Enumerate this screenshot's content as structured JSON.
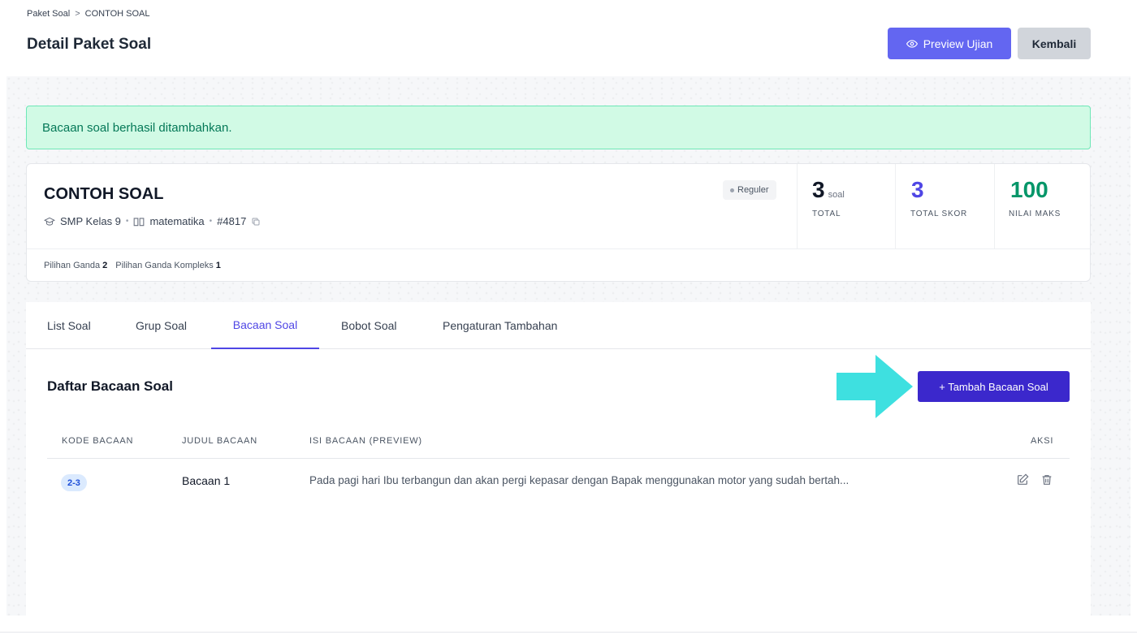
{
  "breadcrumb": {
    "items": [
      "Paket Soal",
      "CONTOH SOAL"
    ],
    "separator": ">"
  },
  "header": {
    "title": "Detail Paket Soal",
    "preview_label": "Preview Ujian",
    "back_label": "Kembali"
  },
  "alert": {
    "message": "Bacaan soal berhasil ditambahkan."
  },
  "package": {
    "title": "CONTOH SOAL",
    "level": "SMP Kelas 9",
    "subject": "matematika",
    "id": "#4817",
    "badge": "Reguler",
    "stats": [
      {
        "value": "3",
        "unit": "soal",
        "label": "TOTAL"
      },
      {
        "value": "3",
        "label": "TOTAL SKOR"
      },
      {
        "value": "100",
        "label": "NILAI MAKS"
      }
    ],
    "type_counts": [
      {
        "label": "Pilihan Ganda",
        "count": "2"
      },
      {
        "label": "Pilihan Ganda Kompleks",
        "count": "1"
      }
    ]
  },
  "tabs": [
    {
      "label": "List Soal",
      "active": false
    },
    {
      "label": "Grup Soal",
      "active": false
    },
    {
      "label": "Bacaan Soal",
      "active": true
    },
    {
      "label": "Bobot Soal",
      "active": false
    },
    {
      "label": "Pengaturan Tambahan",
      "active": false
    }
  ],
  "section": {
    "title": "Daftar Bacaan Soal",
    "add_label": "+ Tambah Bacaan Soal"
  },
  "table": {
    "columns": [
      "KODE BACAAN",
      "JUDUL BACAAN",
      "ISI BACAAN (PREVIEW)",
      "AKSI"
    ],
    "rows": [
      {
        "code": "2-3",
        "title": "Bacaan 1",
        "preview": "Pada pagi hari Ibu terbangun dan akan pergi kepasar dengan Bapak menggunakan motor yang sudah bertah..."
      }
    ]
  },
  "colors": {
    "primary": "#6366f1",
    "primary_dark": "#3b28cc",
    "success_bg": "#d1fae5",
    "success_text": "#047857",
    "stat_skor": "#4f46e5",
    "stat_maks": "#059669",
    "arrow": "#3ee0e0"
  },
  "icons": {
    "preview": "eye-icon",
    "level": "graduation-cap-icon",
    "subject": "book-icon",
    "copy": "copy-icon",
    "edit": "edit-icon",
    "delete": "trash-icon"
  }
}
